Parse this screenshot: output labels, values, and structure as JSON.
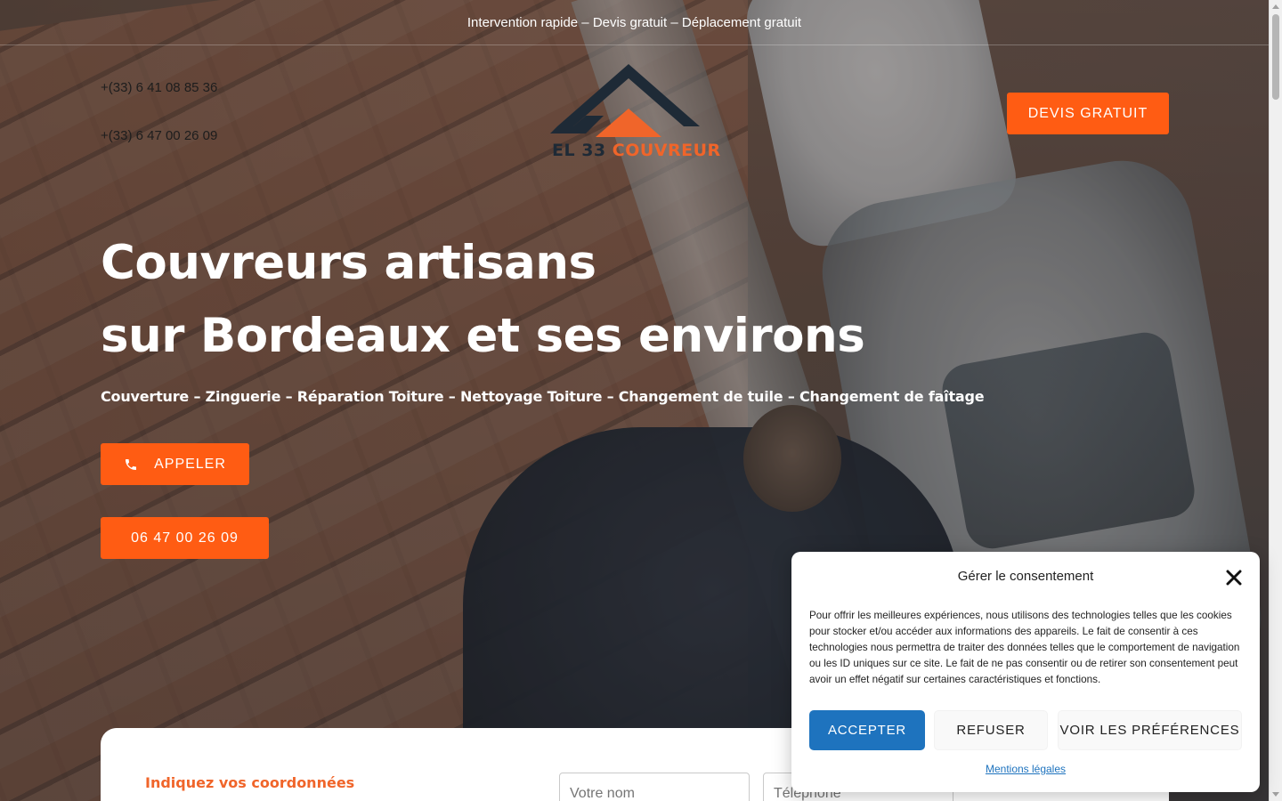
{
  "topbar": {
    "tagline": "Intervention rapide – Devis gratuit – Déplacement gratuit"
  },
  "header": {
    "phones": [
      "+(33) 6 41 08 85 36",
      "+(33) 6 47 00 26 09"
    ],
    "logo": {
      "part1": "EL 33 ",
      "part2": "COUVREUR",
      "dark_color": "#1e2a36",
      "accent_color": "#f0652a"
    },
    "cta_label": "DEVIS GRATUIT"
  },
  "hero": {
    "title_line1": "Couvreurs artisans",
    "title_line2": "sur Bordeaux et ses environs",
    "subtitle": "Couverture – Zinguerie – Réparation Toiture – Nettoyage Toiture – Changement de tuile – Changement de faîtage",
    "call_label": "APPELER",
    "phone_button": "06 47 00 26 09",
    "button_color": "#ff5c13"
  },
  "form": {
    "title": "Indiquez vos coordonnées",
    "name_placeholder": "Votre nom",
    "tel_placeholder": "Téléphone"
  },
  "consent": {
    "title": "Gérer le consentement",
    "text": "Pour offrir les meilleures expériences, nous utilisons des technologies telles que les cookies pour stocker et/ou accéder aux informations des appareils. Le fait de consentir à ces technologies nous permettra de traiter des données telles que le comportement de navigation ou les ID uniques sur ce site. Le fait de ne pas consentir ou de retirer son consentement peut avoir un effet négatif sur certaines caractéristiques et fonctions.",
    "accept_label": "ACCEPTER",
    "refuse_label": "REFUSER",
    "prefs_label": "VOIR LES PRÉFÉRENCES",
    "legal_link": "Mentions légales",
    "accent_color": "#1e73be"
  }
}
